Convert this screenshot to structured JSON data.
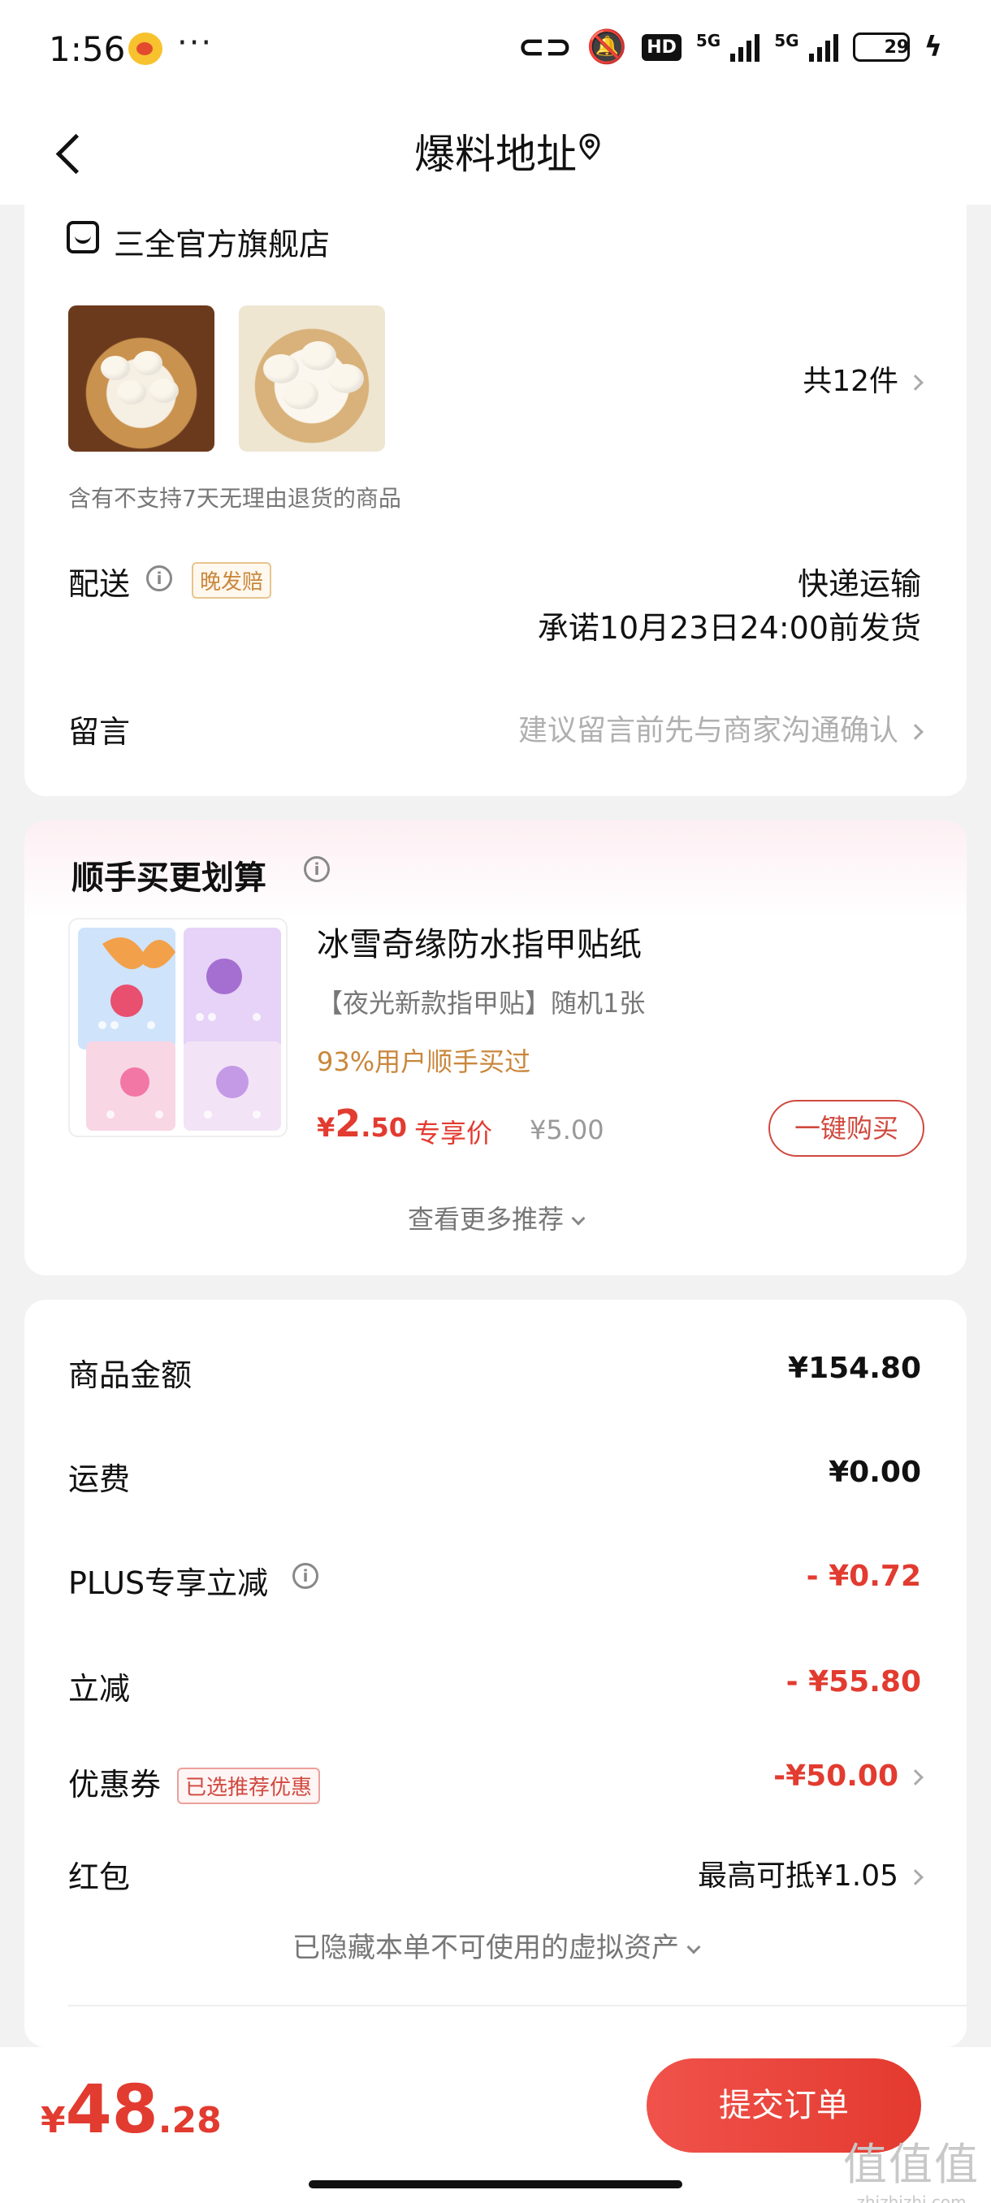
{
  "status_bar": {
    "time": "1:56",
    "dots": "···",
    "hd": "HD",
    "net1": "5G",
    "net2": "5G",
    "battery": "29"
  },
  "header": {
    "title": "爆料地址"
  },
  "store": {
    "name": "三全官方旗舰店",
    "quantity": "共12件",
    "return_note": "含有不支持7天无理由退货的商品",
    "shipping_label": "配送",
    "late_badge": "晚发赔",
    "shipping_method": "快递运输",
    "shipping_promise": "承诺10月23日24:00前发货",
    "message_label": "留言",
    "message_placeholder": "建议留言前先与商家沟通确认"
  },
  "recommend": {
    "title": "顺手买更划算",
    "product_name": "冰雪奇缘防水指甲贴纸",
    "product_sub": "【夜光新款指甲贴】随机1张",
    "buy_percent": "93%用户顺手买过",
    "price_currency": "¥",
    "price_int": "2",
    "price_dec": ".50",
    "price_label": "专享价",
    "original_price": "¥5.00",
    "buy_button": "一键购买",
    "more": "查看更多推荐"
  },
  "summary": {
    "rows": [
      {
        "label": "商品金额",
        "value": "¥154.80"
      },
      {
        "label": "运费",
        "value": "¥0.00"
      },
      {
        "label": "PLUS专享立减",
        "value": "- ¥0.72"
      },
      {
        "label": "立减",
        "value": "- ¥55.80"
      },
      {
        "label": "优惠券",
        "value": "-¥50.00"
      },
      {
        "label": "红包",
        "value": "最高可抵¥1.05"
      }
    ],
    "coupon_badge": "已选推荐优惠",
    "hidden_assets": "已隐藏本单不可使用的虚拟资产"
  },
  "bottom": {
    "currency": "¥",
    "total_int": "48",
    "total_dec": ".28",
    "submit": "提交订单"
  },
  "watermark": {
    "mark": "值值值",
    "url": "zhizhizhi.com"
  },
  "colors": {
    "accent_red": "#e23b30",
    "gold": "#c9873c",
    "background": "#f2f2f2"
  }
}
